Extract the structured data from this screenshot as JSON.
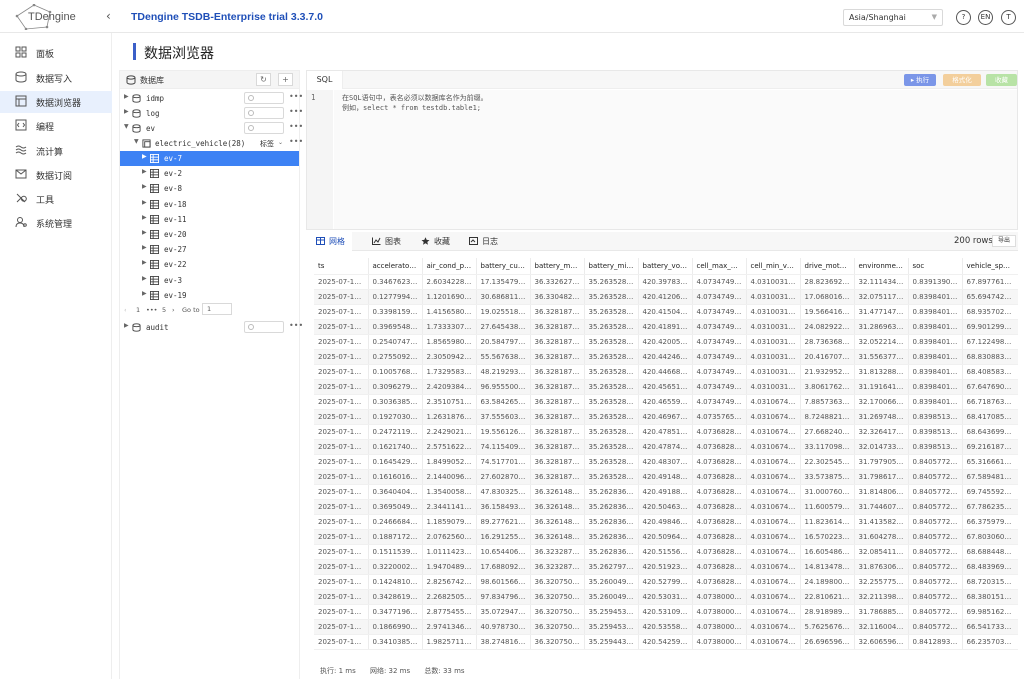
{
  "header": {
    "logo_text": "TDengine",
    "app_title": "TDengine TSDB-Enterprise trial 3.3.7.0",
    "timezone": "Asia/Shanghai",
    "help": "?",
    "lang": "EN",
    "user": "T"
  },
  "nav": [
    {
      "label": "面板",
      "icon": "dashboard-icon"
    },
    {
      "label": "数据写入",
      "icon": "data-insert-icon"
    },
    {
      "label": "数据浏览器",
      "icon": "data-browser-icon",
      "active": true
    },
    {
      "label": "编程",
      "icon": "code-icon"
    },
    {
      "label": "流计算",
      "icon": "stream-icon"
    },
    {
      "label": "数据订阅",
      "icon": "subscribe-icon"
    },
    {
      "label": "工具",
      "icon": "tools-icon"
    },
    {
      "label": "系统管理",
      "icon": "admin-icon"
    }
  ],
  "page_title": "数据浏览器",
  "db_panel": {
    "title": "数据库",
    "refresh": "↻",
    "add": "+",
    "pager": {
      "page_1": "1",
      "dots": "•••",
      "page_5": "5",
      "goto_label": "Go to",
      "goto_value": "1"
    }
  },
  "tree": [
    {
      "label": "idmp",
      "type": "db",
      "expanded": false
    },
    {
      "label": "log",
      "type": "db",
      "expanded": false
    },
    {
      "label": "ev",
      "type": "db",
      "expanded": true
    },
    {
      "label": "electric_vehicle(28)",
      "type": "stable",
      "expanded": true,
      "right": "标签"
    },
    {
      "label": "ev-7",
      "type": "table",
      "selected": true
    },
    {
      "label": "ev-2",
      "type": "table"
    },
    {
      "label": "ev-8",
      "type": "table"
    },
    {
      "label": "ev-18",
      "type": "table"
    },
    {
      "label": "ev-11",
      "type": "table"
    },
    {
      "label": "ev-20",
      "type": "table"
    },
    {
      "label": "ev-27",
      "type": "table"
    },
    {
      "label": "ev-22",
      "type": "table"
    },
    {
      "label": "ev-3",
      "type": "table"
    },
    {
      "label": "ev-19",
      "type": "table"
    },
    {
      "label": "audit",
      "type": "db",
      "expanded": false
    }
  ],
  "editor": {
    "tab": "SQL",
    "run": "▸ 执行",
    "format": "格式化",
    "save": "收藏",
    "line_number": "1",
    "lines": [
      "在SQL语句中，表名必须以数据库名作为前缀。",
      "例如，select * from testdb.table1;"
    ]
  },
  "results": {
    "tabs": [
      {
        "label": "网格",
        "icon": "grid-icon",
        "active": true
      },
      {
        "label": "图表",
        "icon": "chart-icon"
      },
      {
        "label": "收藏",
        "icon": "star-icon"
      },
      {
        "label": "日志",
        "icon": "log-icon"
      }
    ],
    "rows_count": "200 rows",
    "export": "导出",
    "status": {
      "exec": "执行: 1 ms",
      "net": "网络: 32 ms",
      "total": "总数: 33 ms"
    }
  },
  "table": {
    "columns": [
      "ts",
      "accelerator…",
      "air_cond_p…",
      "battery_cur…",
      "battery_ma…",
      "battery_mi…",
      "battery_vol…",
      "cell_max_v…",
      "cell_min_vo…",
      "drive_moto…",
      "environmen…",
      "soc",
      "vehicle_speed"
    ],
    "rows": [
      [
        "2025-07-14…",
        "0.3467623…",
        "2.6034228…",
        "17.135479…",
        "36.332627…",
        "35.263528…",
        "420.39783…",
        "4.0734749…",
        "4.0310031…",
        "28.823692…",
        "32.111434…",
        "0.8391390…",
        "67.897761…"
      ],
      [
        "2025-07-14…",
        "0.1277994…",
        "1.1201690…",
        "30.686811…",
        "36.330482…",
        "35.263528…",
        "420.41206…",
        "4.0734749…",
        "4.0310031…",
        "17.068016…",
        "32.075117…",
        "0.8398401…",
        "65.694742…"
      ],
      [
        "2025-07-14…",
        "0.3398159…",
        "1.4156580…",
        "19.025518…",
        "36.328187…",
        "35.263528…",
        "420.41504…",
        "4.0734749…",
        "4.0310031…",
        "19.566416…",
        "31.477147…",
        "0.8398401…",
        "68.935702…"
      ],
      [
        "2025-07-14…",
        "0.3969548…",
        "1.7333307…",
        "27.645438…",
        "36.328187…",
        "35.263528…",
        "420.41891…",
        "4.0734749…",
        "4.0310031…",
        "24.082922…",
        "31.286963…",
        "0.8398401…",
        "69.901299…"
      ],
      [
        "2025-07-14…",
        "0.2540747…",
        "1.8565980…",
        "20.584797…",
        "36.328187…",
        "35.263528…",
        "420.42005…",
        "4.0734749…",
        "4.0310031…",
        "28.736368…",
        "32.052214…",
        "0.8398401…",
        "67.122498…"
      ],
      [
        "2025-07-14…",
        "0.2755092…",
        "2.3050942…",
        "55.567638…",
        "36.328187…",
        "35.263528…",
        "420.44246…",
        "4.0734749…",
        "4.0310031…",
        "20.416707…",
        "31.556377…",
        "0.8398401…",
        "68.830883…"
      ],
      [
        "2025-07-14…",
        "0.1005768…",
        "1.7329583…",
        "48.219293…",
        "36.328187…",
        "35.263528…",
        "420.44668…",
        "4.0734749…",
        "4.0310031…",
        "21.932952…",
        "31.813288…",
        "0.8398401…",
        "68.408583…"
      ],
      [
        "2025-07-14…",
        "0.3096279…",
        "2.4209384…",
        "96.955500…",
        "36.328187…",
        "35.263528…",
        "420.45651…",
        "4.0734749…",
        "4.0310031…",
        "3.8061762…",
        "31.191641…",
        "0.8398401…",
        "67.647690…"
      ],
      [
        "2025-07-14…",
        "0.3036385…",
        "2.3510751…",
        "63.584265…",
        "36.328187…",
        "35.263528…",
        "420.46559…",
        "4.0734749…",
        "4.0310674…",
        "7.8857363…",
        "32.170066…",
        "0.8398401…",
        "66.718763…"
      ],
      [
        "2025-07-14…",
        "0.1927030…",
        "1.2631876…",
        "37.555603…",
        "36.328187…",
        "35.263528…",
        "420.46967…",
        "4.0735765…",
        "4.0310674…",
        "8.7248821…",
        "31.269748…",
        "0.8398513…",
        "68.417085…"
      ],
      [
        "2025-07-14…",
        "0.2472119…",
        "2.2429021…",
        "19.556126…",
        "36.328187…",
        "35.263528…",
        "420.47851…",
        "4.0736828…",
        "4.0310674…",
        "27.668240…",
        "32.326417…",
        "0.8398513…",
        "68.643699…"
      ],
      [
        "2025-07-14…",
        "0.1621740…",
        "2.5751622…",
        "74.115409…",
        "36.328187…",
        "35.263528…",
        "420.47874…",
        "4.0736828…",
        "4.0310674…",
        "33.117098…",
        "32.014733…",
        "0.8398513…",
        "69.216187…"
      ],
      [
        "2025-07-14…",
        "0.1645429…",
        "1.8499052…",
        "74.517701…",
        "36.328187…",
        "35.263528…",
        "420.48307…",
        "4.0736828…",
        "4.0310674…",
        "22.302545…",
        "31.797905…",
        "0.8405772…",
        "65.316661…"
      ],
      [
        "2025-07-14…",
        "0.1616016…",
        "2.1440096…",
        "27.602870…",
        "36.328187…",
        "35.263528…",
        "420.49148…",
        "4.0736828…",
        "4.0310674…",
        "33.573875…",
        "31.798617…",
        "0.8405772…",
        "67.589481…"
      ],
      [
        "2025-07-14…",
        "0.3640404…",
        "1.3540058…",
        "47.830325…",
        "36.326148…",
        "35.262836…",
        "420.49188…",
        "4.0736828…",
        "4.0310674…",
        "31.000760…",
        "31.814806…",
        "0.8405772…",
        "69.745592…"
      ],
      [
        "2025-07-14…",
        "0.3695049…",
        "2.3441141…",
        "36.158493…",
        "36.326148…",
        "35.262836…",
        "420.50463…",
        "4.0736828…",
        "4.0310674…",
        "11.600579…",
        "31.744607…",
        "0.8405772…",
        "67.786235…"
      ],
      [
        "2025-07-14…",
        "0.2466684…",
        "1.1859079…",
        "89.277621…",
        "36.326148…",
        "35.262836…",
        "420.49846…",
        "4.0736828…",
        "4.0310674…",
        "11.823614…",
        "31.413582…",
        "0.8405772…",
        "66.375979…"
      ],
      [
        "2025-07-14…",
        "0.1887172…",
        "2.0762560…",
        "16.291255…",
        "36.326148…",
        "35.262836…",
        "420.50964…",
        "4.0736828…",
        "4.0310674…",
        "16.570223…",
        "31.604278…",
        "0.8405772…",
        "67.803060…"
      ],
      [
        "2025-07-14…",
        "0.1511539…",
        "1.0111423…",
        "10.654406…",
        "36.323287…",
        "35.262836…",
        "420.51556…",
        "4.0736828…",
        "4.0310674…",
        "16.605486…",
        "32.085411…",
        "0.8405772…",
        "68.688448…"
      ],
      [
        "2025-07-14…",
        "0.3220002…",
        "1.9470489…",
        "17.688092…",
        "36.323287…",
        "35.262797…",
        "420.51923…",
        "4.0736828…",
        "4.0310674…",
        "14.813478…",
        "31.876306…",
        "0.8405772…",
        "68.483969…"
      ],
      [
        "2025-07-14…",
        "0.1424810…",
        "2.8256742…",
        "98.601566…",
        "36.320750…",
        "35.260049…",
        "420.52799…",
        "4.0736828…",
        "4.0310674…",
        "24.189800…",
        "32.255775…",
        "0.8405772…",
        "68.720315…"
      ],
      [
        "2025-07-14…",
        "0.3428619…",
        "2.2682505…",
        "97.834796…",
        "36.320750…",
        "35.260049…",
        "420.53031…",
        "4.0738000…",
        "4.0310674…",
        "22.810621…",
        "32.211398…",
        "0.8405772…",
        "68.380151…"
      ],
      [
        "2025-07-14…",
        "0.3477196…",
        "2.8775455…",
        "35.072947…",
        "36.320750…",
        "35.259453…",
        "420.53109…",
        "4.0738000…",
        "4.0310674…",
        "28.918989…",
        "31.786885…",
        "0.8405772…",
        "69.985162…"
      ],
      [
        "2025-07-14…",
        "0.1866990…",
        "2.9741346…",
        "40.978730…",
        "36.320750…",
        "35.259453…",
        "420.53558…",
        "4.0738000…",
        "4.0310674…",
        "5.7625676…",
        "32.116004…",
        "0.8405772…",
        "66.541733…"
      ],
      [
        "2025-07-14…",
        "0.3410385…",
        "1.9825711…",
        "38.274816…",
        "36.320750…",
        "35.259443…",
        "420.54259…",
        "4.0738000…",
        "4.0310674…",
        "26.696596…",
        "32.606596…",
        "0.8412893…",
        "66.235703…"
      ]
    ]
  }
}
